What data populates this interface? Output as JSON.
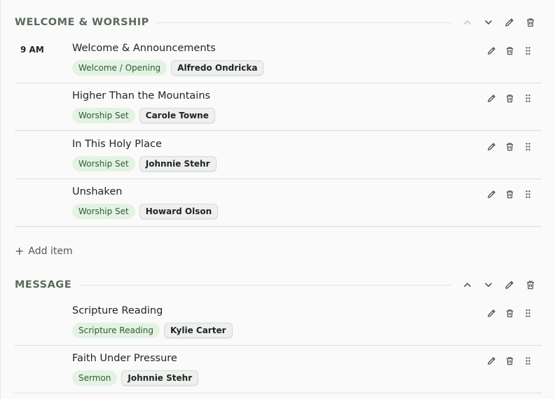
{
  "colors": {
    "section_title": "#5b6a5c",
    "tag_type_bg": "#e3f3e3",
    "tag_type_text": "#2f5a34",
    "tag_person_bg": "#eef0ee"
  },
  "sections": [
    {
      "title": "WELCOME & WORSHIP",
      "items": [
        {
          "time": "9 AM",
          "title": "Welcome & Announcements",
          "type": "Welcome / Opening",
          "person": "Alfredo Ondricka"
        },
        {
          "time": "",
          "title": "Higher Than the Mountains",
          "type": "Worship Set",
          "person": "Carole Towne"
        },
        {
          "time": "",
          "title": "In This Holy Place",
          "type": "Worship Set",
          "person": "Johnnie Stehr"
        },
        {
          "time": "",
          "title": "Unshaken",
          "type": "Worship Set",
          "person": "Howard Olson"
        }
      ],
      "add_item_label": "Add item"
    },
    {
      "title": "MESSAGE",
      "items": [
        {
          "time": "",
          "title": "Scripture Reading",
          "type": "Scripture Reading",
          "person": "Kylie Carter"
        },
        {
          "time": "",
          "title": "Faith Under Pressure",
          "type": "Sermon",
          "person": "Johnnie Stehr"
        }
      ]
    }
  ],
  "icons": {
    "section_actions": [
      "chevron-up-icon",
      "chevron-down-icon",
      "pencil-icon",
      "trash-icon"
    ],
    "item_actions": [
      "pencil-icon",
      "trash-icon",
      "drag-handle-icon"
    ]
  }
}
